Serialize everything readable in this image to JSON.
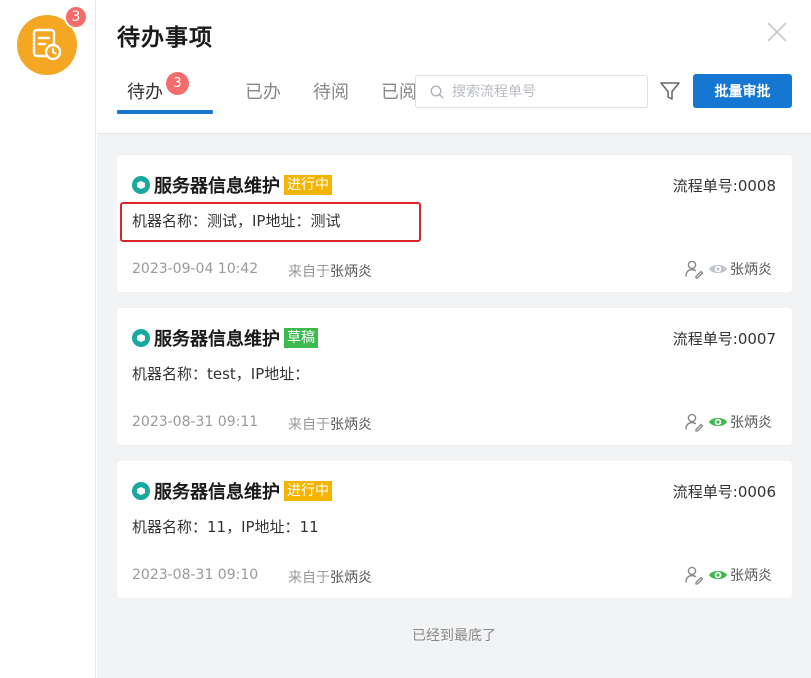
{
  "app": {
    "badge_count": "3"
  },
  "header": {
    "title": "待办事项",
    "tabs": [
      {
        "label": "待办",
        "badge": "3",
        "active": true
      },
      {
        "label": "已办"
      },
      {
        "label": "待阅"
      },
      {
        "label": "已阅"
      }
    ],
    "search_placeholder": "搜索流程单号",
    "batch_button": "批量审批"
  },
  "cards": [
    {
      "title": "服务器信息维护",
      "status": "进行中",
      "flow_no": "流程单号:0008",
      "desc": "机器名称：测试，IP地址：测试",
      "time": "2023-09-04 10:42",
      "from_prefix": "来自于",
      "from_name": "张炳炎",
      "viewer": "张炳炎",
      "eye_color": "#c0c4cc",
      "highlighted": true
    },
    {
      "title": "服务器信息维护",
      "status": "草稿",
      "flow_no": "流程单号:0007",
      "desc": "机器名称：test，IP地址：",
      "time": "2023-08-31 09:11",
      "from_prefix": "来自于",
      "from_name": "张炳炎",
      "viewer": "张炳炎",
      "eye_color": "#3dba4e"
    },
    {
      "title": "服务器信息维护",
      "status": "进行中",
      "flow_no": "流程单号:0006",
      "desc": "机器名称：11，IP地址：11",
      "time": "2023-08-31 09:10",
      "from_prefix": "来自于",
      "from_name": "张炳炎",
      "viewer": "张炳炎",
      "eye_color": "#3dba4e"
    }
  ],
  "footer": {
    "end_text": "已经到最底了"
  },
  "colors": {
    "accent": "#1677d2",
    "badge": "#f56c6c",
    "app_icon": "#f5a623",
    "running": "#f5b400",
    "draft": "#3dba4e",
    "highlight": "#d7272d"
  }
}
